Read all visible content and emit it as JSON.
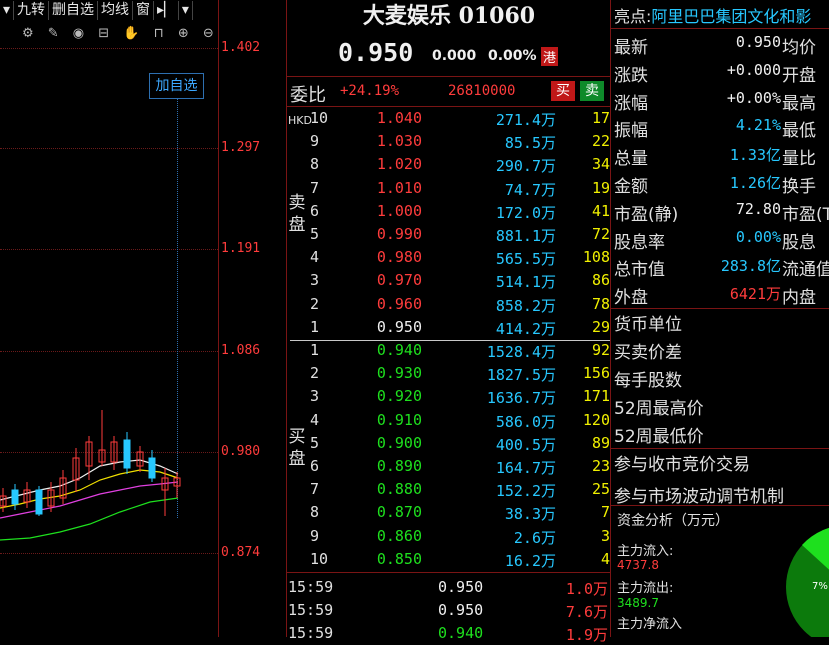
{
  "toolbar": {
    "items": [
      "▾",
      "九转",
      "删自选",
      "均线",
      "窗",
      "▸▏",
      "▾"
    ]
  },
  "chart_tools": "⚙ ✎ ◉ ⊟ ✋ ⊓ ⊕ ⊖",
  "add_watch": "加自选",
  "axis": [
    "1.402",
    "1.297",
    "1.191",
    "1.086",
    "0.980",
    "0.874"
  ],
  "stock": {
    "name": "大麦娱乐",
    "code": "01060",
    "price": "0.950",
    "change": "0.000",
    "pct": "0.00%",
    "market": "港"
  },
  "entrust": {
    "label": "委比",
    "ratio": "+24.19%",
    "diff": "26810000",
    "buy": "买",
    "sell": "卖"
  },
  "book": {
    "hkd": "HKD",
    "sell_label": "卖",
    "sell_label2": "盘",
    "buy_label": "买",
    "buy_label2": "盘",
    "asks": [
      {
        "lv": "10",
        "p": "1.040",
        "v": "271.4万",
        "c": "17"
      },
      {
        "lv": "9",
        "p": "1.030",
        "v": "85.5万",
        "c": "22"
      },
      {
        "lv": "8",
        "p": "1.020",
        "v": "290.7万",
        "c": "34"
      },
      {
        "lv": "7",
        "p": "1.010",
        "v": "74.7万",
        "c": "19"
      },
      {
        "lv": "6",
        "p": "1.000",
        "v": "172.0万",
        "c": "41"
      },
      {
        "lv": "5",
        "p": "0.990",
        "v": "881.1万",
        "c": "72"
      },
      {
        "lv": "4",
        "p": "0.980",
        "v": "565.5万",
        "c": "108"
      },
      {
        "lv": "3",
        "p": "0.970",
        "v": "514.1万",
        "c": "86"
      },
      {
        "lv": "2",
        "p": "0.960",
        "v": "858.2万",
        "c": "78"
      },
      {
        "lv": "1",
        "p": "0.950",
        "v": "414.2万",
        "c": "29"
      }
    ],
    "bids": [
      {
        "lv": "1",
        "p": "0.940",
        "v": "1528.4万",
        "c": "92"
      },
      {
        "lv": "2",
        "p": "0.930",
        "v": "1827.5万",
        "c": "156"
      },
      {
        "lv": "3",
        "p": "0.920",
        "v": "1636.7万",
        "c": "171"
      },
      {
        "lv": "4",
        "p": "0.910",
        "v": "586.0万",
        "c": "120"
      },
      {
        "lv": "5",
        "p": "0.900",
        "v": "400.5万",
        "c": "89"
      },
      {
        "lv": "6",
        "p": "0.890",
        "v": "164.7万",
        "c": "23"
      },
      {
        "lv": "7",
        "p": "0.880",
        "v": "152.2万",
        "c": "25"
      },
      {
        "lv": "8",
        "p": "0.870",
        "v": "38.3万",
        "c": "7"
      },
      {
        "lv": "9",
        "p": "0.860",
        "v": "2.6万",
        "c": "3"
      },
      {
        "lv": "10",
        "p": "0.850",
        "v": "16.2万",
        "c": "4"
      }
    ]
  },
  "ticks": [
    {
      "t": "15:59",
      "p": "0.950",
      "v": "1.0万"
    },
    {
      "t": "15:59",
      "p": "0.950",
      "v": "7.6万"
    },
    {
      "t": "15:59",
      "p": "0.940",
      "v": "1.9万"
    }
  ],
  "highlight": {
    "label": "亮点:",
    "text": "阿里巴巴集团文化和影"
  },
  "info": [
    {
      "l": "最新",
      "v": "0.950",
      "l2": "均价"
    },
    {
      "l": "涨跌",
      "v": "+0.000",
      "l2": "开盘"
    },
    {
      "l": "涨幅",
      "v": "+0.00%",
      "l2": "最高"
    },
    {
      "l": "振幅",
      "v": "4.21%",
      "l2": "最低"
    },
    {
      "l": "总量",
      "v": "1.33亿",
      "l2": "量比"
    },
    {
      "l": "金额",
      "v": "1.26亿",
      "l2": "换手"
    },
    {
      "l": "市盈(静)",
      "v": "72.80",
      "l2": "市盈(T"
    },
    {
      "l": "股息率",
      "v": "0.00%",
      "l2": "股息"
    },
    {
      "l": "总市值",
      "v": "283.8亿",
      "l2": "流通值"
    },
    {
      "l": "外盘",
      "v": "6421万",
      "l2": "内盘"
    }
  ],
  "extra": [
    "货币单位",
    "买卖价差",
    "每手股数",
    "52周最高价",
    "52周最低价",
    "参与收市竞价交易",
    "参与市场波动调节机制"
  ],
  "fund": {
    "title": "资金分析（万元）",
    "in_label": "主力流入:",
    "in_val": "4737.8",
    "out_label": "主力流出:",
    "out_val": "3489.7",
    "net_label": "主力净流入",
    "pie_pct": "7%"
  },
  "colors": {
    "red": "#ff3c3c",
    "green": "#1ee01e",
    "cyan": "#27c8ff",
    "yellow": "#f0f000",
    "grid": "#7a1414"
  }
}
